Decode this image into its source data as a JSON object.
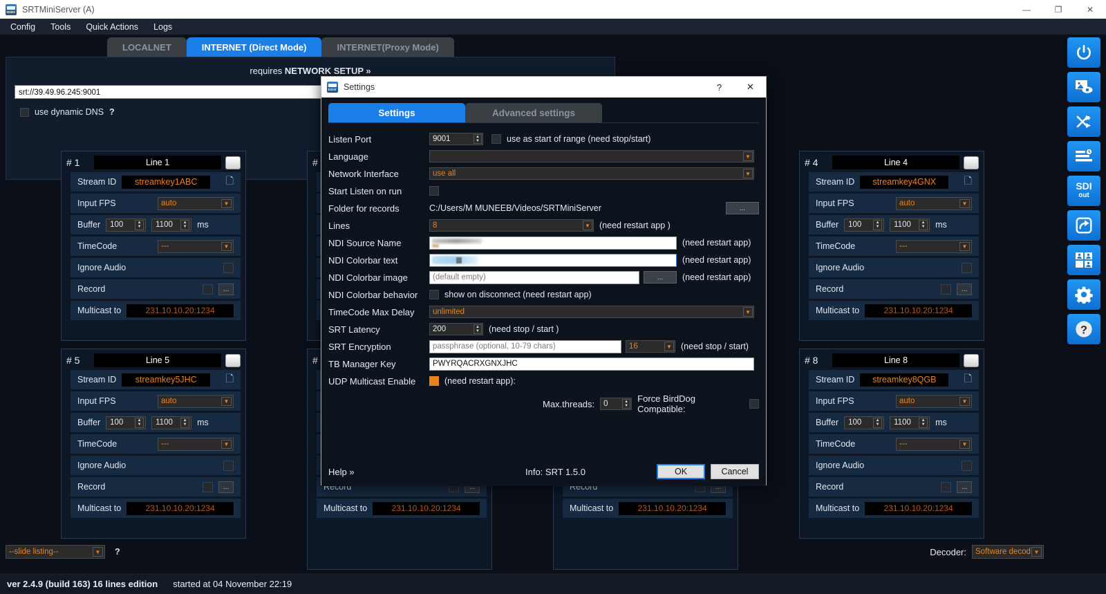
{
  "window": {
    "title": "SRTMiniServer (A)",
    "icon": "app-icon",
    "controls": {
      "minimize": "—",
      "maximize": "❐",
      "close": "✕"
    }
  },
  "menubar": {
    "items": [
      "Config",
      "Tools",
      "Quick Actions",
      "Logs"
    ]
  },
  "mode_tabs": [
    {
      "label": "LOCALNET",
      "active": false
    },
    {
      "label": "INTERNET (Direct Mode)",
      "active": true
    },
    {
      "label": "INTERNET(Proxy Mode)",
      "active": false
    }
  ],
  "network_panel": {
    "title_prefix": "requires ",
    "title_strong": "NETWORK SETUP »",
    "url_value": "srt://39.49.96.245:9001",
    "dynamic_dns_label": "use dynamic DNS",
    "help_mark": "?"
  },
  "line_card_labels": {
    "stream_id": "Stream ID",
    "input_fps": "Input FPS",
    "buffer": "Buffer",
    "ms": "ms",
    "timecode": "TimeCode",
    "ignore_audio": "Ignore Audio",
    "record": "Record",
    "multicast_to": "Multicast to",
    "dots": "...",
    "copy_icon": "copy-icon",
    "arrow": "▼"
  },
  "lines": [
    {
      "num": "# 1",
      "name": "Line 1",
      "stream_id": "streamkey1ABC",
      "fps": "auto",
      "buffer_min": "100",
      "buffer_max": "1100",
      "timecode": "---",
      "multicast": "231.10.10.20:1234"
    },
    {
      "num": "# 4",
      "name": "Line 4",
      "stream_id": "streamkey4GNX",
      "fps": "auto",
      "buffer_min": "100",
      "buffer_max": "1100",
      "timecode": "---",
      "multicast": "231.10.10.20:1234"
    },
    {
      "num": "# 5",
      "name": "Line 5",
      "stream_id": "streamkey5JHC",
      "fps": "auto",
      "buffer_min": "100",
      "buffer_max": "1100",
      "timecode": "---",
      "multicast": "231.10.10.20:1234"
    },
    {
      "num": "# 8",
      "name": "Line 8",
      "stream_id": "streamkey8QGB",
      "fps": "auto",
      "buffer_min": "100",
      "buffer_max": "1100",
      "timecode": "---",
      "multicast": "231.10.10.20:1234"
    }
  ],
  "occluded_lines": [
    {
      "num": "#",
      "record": "Record",
      "multicast": "231.10.10.20:1234"
    },
    {
      "num": "#",
      "record": "Record",
      "multicast": "231.10.10.20:1234"
    }
  ],
  "sidebar": {
    "buttons": [
      {
        "name": "power-icon",
        "label": ""
      },
      {
        "name": "preview-image-icon",
        "label": ""
      },
      {
        "name": "shuffle-icon",
        "label": ""
      },
      {
        "name": "schedule-list-icon",
        "label": ""
      },
      {
        "name": "sdi-out-icon",
        "label": "SDI",
        "sub": "out"
      },
      {
        "name": "share-forward-icon",
        "label": ""
      },
      {
        "name": "multiview-grid-icon",
        "label": ""
      },
      {
        "name": "gear-icon",
        "label": ""
      },
      {
        "name": "help-question-icon",
        "label": ""
      }
    ]
  },
  "bottom": {
    "slide_listing": "--slide listing--",
    "slide_help": "?",
    "decoder_label": "Decoder:",
    "decoder_value": "Software decod",
    "arrow": "▼"
  },
  "statusbar": {
    "version": "ver 2.4.9 (build 163) 16 lines edition",
    "started": "started at 04 November 22:19"
  },
  "dialog": {
    "title": "Settings",
    "help_btn": "?",
    "close_btn": "✕",
    "tabs": [
      {
        "label": "Settings",
        "active": true
      },
      {
        "label": "Advanced settings",
        "active": false
      }
    ],
    "fields": {
      "listen_port_label": "Listen Port",
      "listen_port_value": "9001",
      "listen_port_note": "use as start of range (need stop/start)",
      "language_label": "Language",
      "language_value": "",
      "network_interface_label": "Network Interface",
      "network_interface_value": "use all",
      "start_listen_label": "Start Listen on run",
      "folder_label": "Folder for records",
      "folder_value": "C:/Users/M MUNEEB/Videos/SRTMiniServer",
      "folder_browse": "...",
      "lines_label": "Lines",
      "lines_value": "8",
      "lines_note": "(need restart app )",
      "ndi_source_label": "NDI Source Name",
      "ndi_source_value": "",
      "ndi_source_note": "(need restart app)",
      "ndi_colorbar_text_label": "NDI Colorbar text",
      "ndi_colorbar_text_value": "",
      "ndi_colorbar_text_note": "(need restart app)",
      "ndi_colorbar_image_label": "NDI Colorbar image",
      "ndi_colorbar_image_placeholder": "(default empty)",
      "ndi_colorbar_image_browse": "...",
      "ndi_colorbar_image_note": "(need restart app)",
      "ndi_colorbar_behavior_label": "NDI Colorbar behavior",
      "ndi_colorbar_behavior_note": "show on disconnect (need restart app)",
      "timecode_delay_label": "TimeCode Max Delay",
      "timecode_delay_value": "unlimited",
      "srt_latency_label": "SRT Latency",
      "srt_latency_value": "200",
      "srt_latency_note": "(need stop / start )",
      "srt_encryption_label": "SRT Encryption",
      "srt_encryption_placeholder": "passphrase (optional, 10-79 chars)",
      "srt_encryption_bits": "16",
      "srt_encryption_note": "(need stop / start)",
      "tb_manager_label": "TB Manager Key",
      "tb_manager_value": "PWYRQACRXGNXJHC",
      "udp_multicast_label": "UDP Multicast Enable",
      "udp_multicast_note": "(need restart app):",
      "max_threads_label": "Max.threads:",
      "max_threads_value": "0",
      "force_birddog_label": "Force BirdDog Compatible:"
    },
    "footer": {
      "help": "Help »",
      "info": "Info: SRT 1.5.0",
      "ok": "OK",
      "cancel": "Cancel"
    }
  },
  "colors": {
    "accent_blue": "#1a7fe8",
    "accent_orange": "#e8821e",
    "panel_bg": "#0d1725",
    "row_bg": "#162a42",
    "app_bg": "#0a0f18"
  }
}
